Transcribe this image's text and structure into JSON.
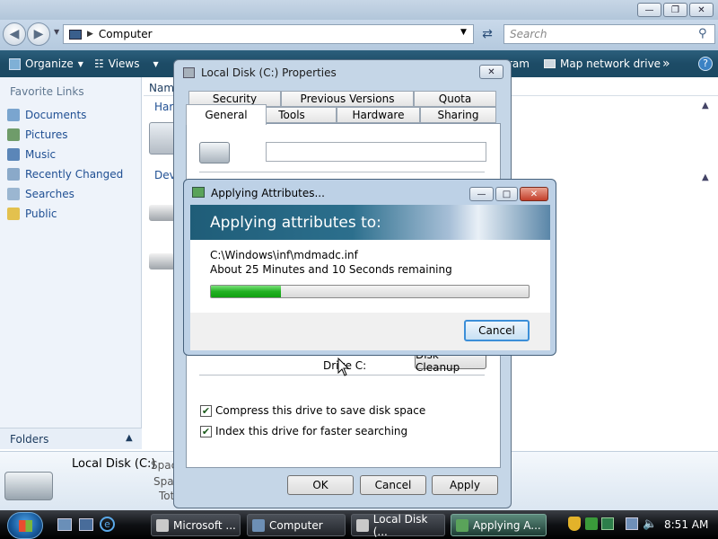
{
  "explorer": {
    "address_path": "Computer",
    "search_placeholder": "Search",
    "toolbar": {
      "organize": "Organize",
      "views": "Views",
      "ram_partial": "ram",
      "map_network_drive": "Map network drive",
      "more": "»"
    },
    "column_partial": "Nam",
    "section_hard_partial": "Hard",
    "section_devices_partial": "Devi",
    "favorite_links_title": "Favorite Links",
    "favorite_links": [
      "Documents",
      "Pictures",
      "Music",
      "Recently Changed",
      "Searches",
      "Public"
    ],
    "folders_label": "Folders",
    "details": {
      "title": "Local Disk (C:)",
      "label1": "Spac",
      "label2": "Spac",
      "label3": "Tot"
    }
  },
  "properties_dialog": {
    "title": "Local Disk (C:) Properties",
    "tabs_top": [
      "Security",
      "Previous Versions",
      "Quota"
    ],
    "tabs_bottom": [
      "General",
      "Tools",
      "Hardware",
      "Sharing"
    ],
    "active_tab": "General",
    "drive_label_value": "",
    "drive_caption": "Drive C:",
    "disk_cleanup": "Disk Cleanup",
    "compress_label": "Compress this drive to save disk space",
    "index_label": "Index this drive for faster searching",
    "compress_checked": true,
    "index_checked": true,
    "ok": "OK",
    "cancel": "Cancel",
    "apply": "Apply"
  },
  "apply_dialog": {
    "title": "Applying Attributes...",
    "heading": "Applying attributes to:",
    "file_path": "C:\\Windows\\inf\\mdmadc.inf",
    "time_remaining": "About 25 Minutes and 10 Seconds remaining",
    "progress_fraction": 0.22,
    "cancel": "Cancel"
  },
  "taskbar": {
    "tasks": [
      "Microsoft ...",
      "Computer",
      "Local Disk (...",
      "Applying A..."
    ],
    "active_task_index": 3,
    "clock": "8:51 AM"
  }
}
